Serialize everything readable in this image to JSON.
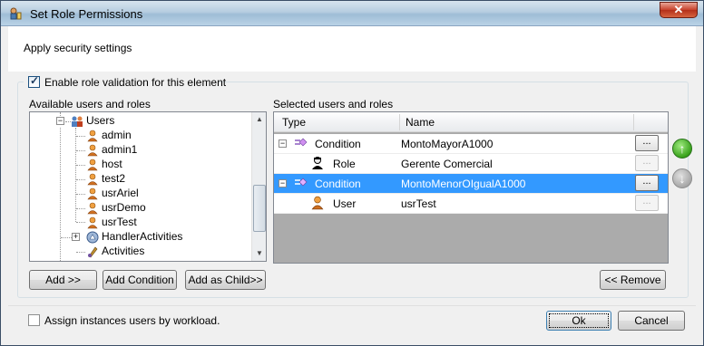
{
  "window": {
    "title": "Set Role Permissions",
    "close_symbol": "✕"
  },
  "header": {
    "subtitle": "Apply security settings"
  },
  "validation": {
    "label": "Enable role validation for this element",
    "checked": true
  },
  "available": {
    "label": "Available users and roles",
    "users_node": "Users",
    "users": [
      "admin",
      "admin1",
      "host",
      "test2",
      "usrAriel",
      "usrDemo",
      "usrTest"
    ],
    "handler_node": "HandlerActivities",
    "activities_node": "Activities"
  },
  "selected": {
    "label": "Selected users and roles",
    "col_type": "Type",
    "col_name": "Name",
    "rows": [
      {
        "type": "Condition",
        "name": "MontoMayorA1000"
      },
      {
        "type": "Role",
        "name": "Gerente Comercial"
      },
      {
        "type": "Condition",
        "name": "MontoMenorOIgualA1000"
      },
      {
        "type": "User",
        "name": "usrTest"
      }
    ],
    "ellipsis": "...",
    "expander_symbol": "−"
  },
  "buttons": {
    "add": "Add >>",
    "add_condition": "Add Condition",
    "add_child": "Add as Child>>",
    "remove": "<< Remove",
    "ok": "Ok",
    "cancel": "Cancel",
    "move_up": "↑",
    "move_down": "↓"
  },
  "workload": {
    "label": "Assign instances users by workload.",
    "checked": false
  },
  "tree_symbols": {
    "collapse": "−",
    "expand": "+",
    "check": "✓"
  },
  "colors": {
    "selection": "#3399ff",
    "up_arrow": "#39a21c",
    "down_arrow": "#a8a8a8"
  }
}
